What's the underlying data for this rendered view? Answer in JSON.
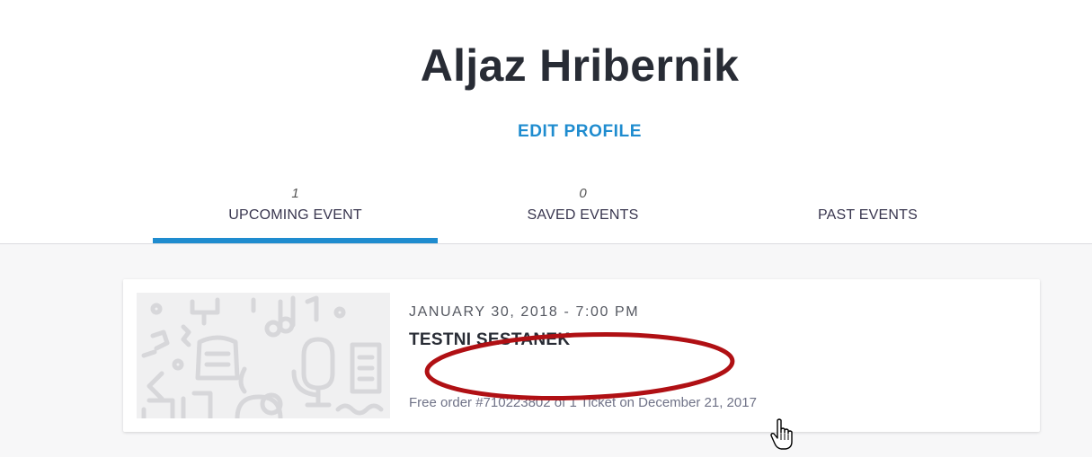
{
  "profile": {
    "name": "Aljaz Hribernik",
    "edit_label": "EDIT PROFILE"
  },
  "tabs": [
    {
      "count": "1",
      "label": "UPCOMING EVENT",
      "active": true
    },
    {
      "count": "0",
      "label": "SAVED EVENTS",
      "active": false
    },
    {
      "count": "",
      "label": "PAST EVENTS",
      "active": false
    }
  ],
  "event": {
    "date": "JANUARY 30, 2018 - 7:00 PM",
    "title": "TESTNI SESTANEK",
    "order": "Free order #710223802 of 1 Ticket on December 21, 2017",
    "thumbnail_icon": "doodle-pattern-icon"
  },
  "annotation": {
    "color": "#b01014",
    "shape": "ellipse"
  },
  "colors": {
    "accent": "#1f8ccf",
    "background": "#f7f7f8",
    "title": "#282c35"
  },
  "cursor": "hand-pointer-icon"
}
